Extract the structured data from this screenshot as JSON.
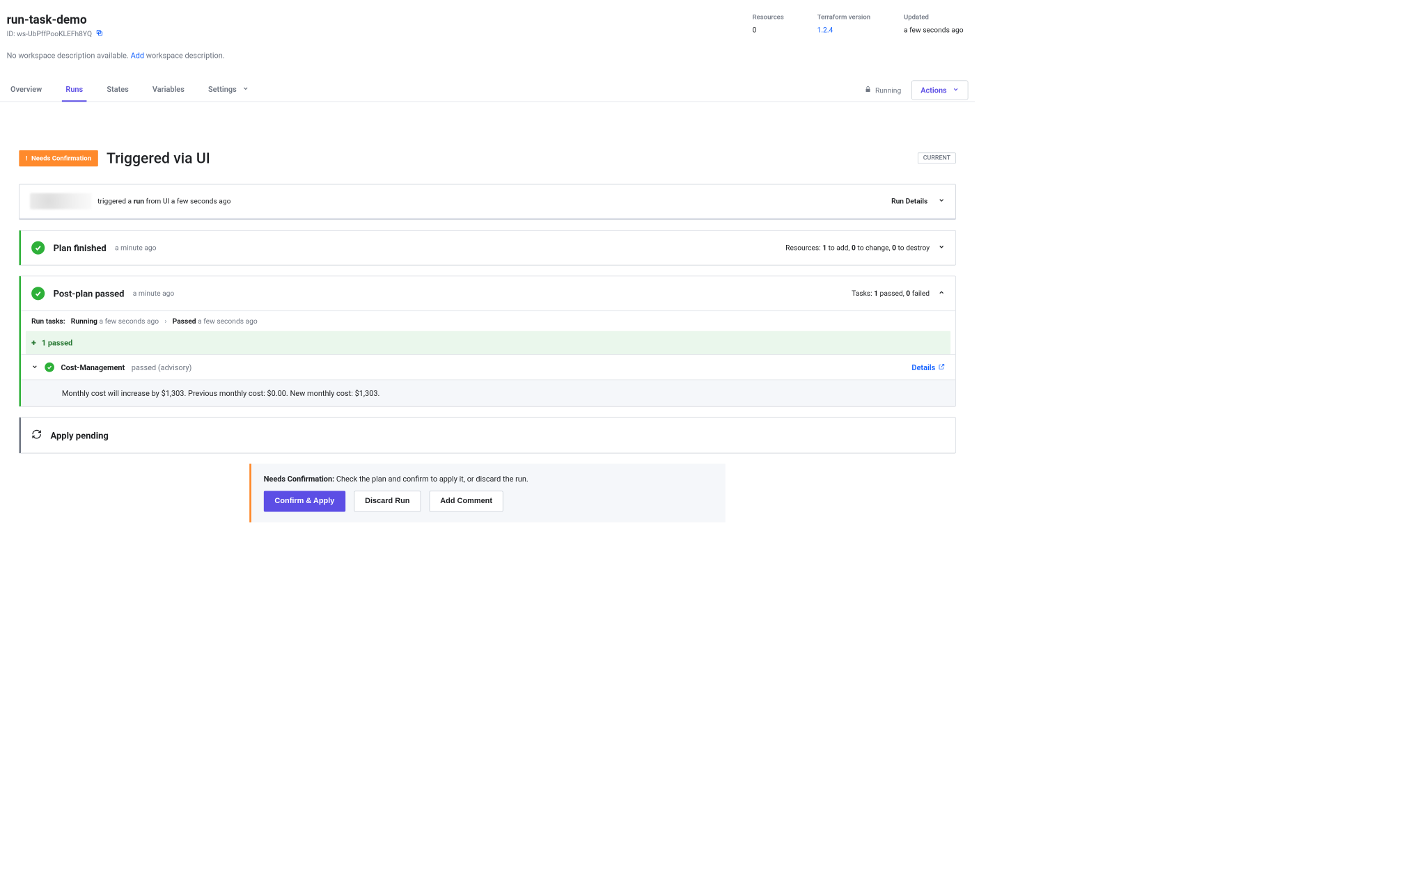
{
  "workspace": {
    "title": "run-task-demo",
    "id_prefix": "ID:",
    "id": "ws-UbPffPooKLEFh8YQ",
    "description_empty": "No workspace description available.",
    "add_link": "Add",
    "add_suffix": "workspace description."
  },
  "stats": {
    "resources_label": "Resources",
    "resources_value": "0",
    "tf_label": "Terraform version",
    "tf_value": "1.2.4",
    "updated_label": "Updated",
    "updated_value": "a few seconds ago"
  },
  "tabs": {
    "overview": "Overview",
    "runs": "Runs",
    "states": "States",
    "variables": "Variables",
    "settings": "Settings"
  },
  "toolbar": {
    "lock_status": "Running",
    "actions": "Actions"
  },
  "run": {
    "badge": "Needs Confirmation",
    "title": "Triggered via UI",
    "current": "CURRENT",
    "trigger_text_1": "triggered a",
    "trigger_run": "run",
    "trigger_text_2": "from UI a few seconds ago",
    "run_details": "Run Details"
  },
  "plan": {
    "title": "Plan finished",
    "time": "a minute ago",
    "resources_prefix": "Resources:",
    "to_add_n": "1",
    "to_add": "to add,",
    "to_change_n": "0",
    "to_change": "to change,",
    "to_destroy_n": "0",
    "to_destroy": "to destroy"
  },
  "postplan": {
    "title": "Post-plan passed",
    "time": "a minute ago",
    "tasks_prefix": "Tasks:",
    "passed_n": "1",
    "passed": "passed,",
    "failed_n": "0",
    "failed": "failed",
    "bar_label": "Run tasks:",
    "bar_running": "Running",
    "bar_running_time": "a few seconds ago",
    "bar_passed": "Passed",
    "bar_passed_time": "a few seconds ago",
    "strip": "1 passed",
    "task_name": "Cost-Management",
    "task_status": "passed (advisory)",
    "details": "Details",
    "message": "Monthly cost will increase by $1,303. Previous monthly cost: $0.00. New monthly cost: $1,303."
  },
  "apply": {
    "title": "Apply pending"
  },
  "confirm": {
    "label": "Needs Confirmation:",
    "text": "Check the plan and confirm to apply it, or discard the run.",
    "apply_btn": "Confirm & Apply",
    "discard_btn": "Discard Run",
    "comment_btn": "Add Comment"
  }
}
